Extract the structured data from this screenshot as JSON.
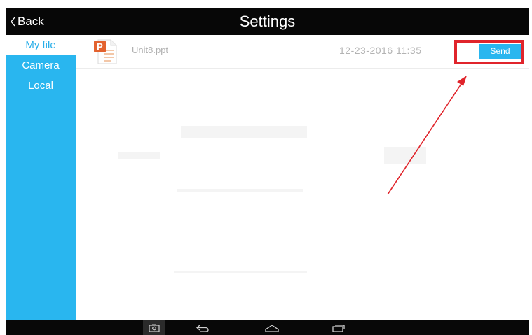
{
  "titlebar": {
    "back_label": "Back",
    "title": "Settings"
  },
  "sidebar": {
    "items": [
      {
        "label": "My file",
        "active": true
      },
      {
        "label": "Camera",
        "active": false
      },
      {
        "label": "Local",
        "active": false
      }
    ]
  },
  "files": [
    {
      "name": "Unit8.ppt",
      "date": "12-23-2016 11:35",
      "action_label": "Send",
      "icon": "powerpoint-file-icon"
    }
  ],
  "annotation": {
    "highlight_color": "#e0242b",
    "arrow_color": "#e0242b",
    "target": "send-button"
  },
  "navbar": {
    "icons": [
      "screenshot-icon",
      "back-icon",
      "home-icon",
      "recent-apps-icon"
    ]
  },
  "colors": {
    "accent": "#29b6ef",
    "titlebar": "#070707"
  }
}
